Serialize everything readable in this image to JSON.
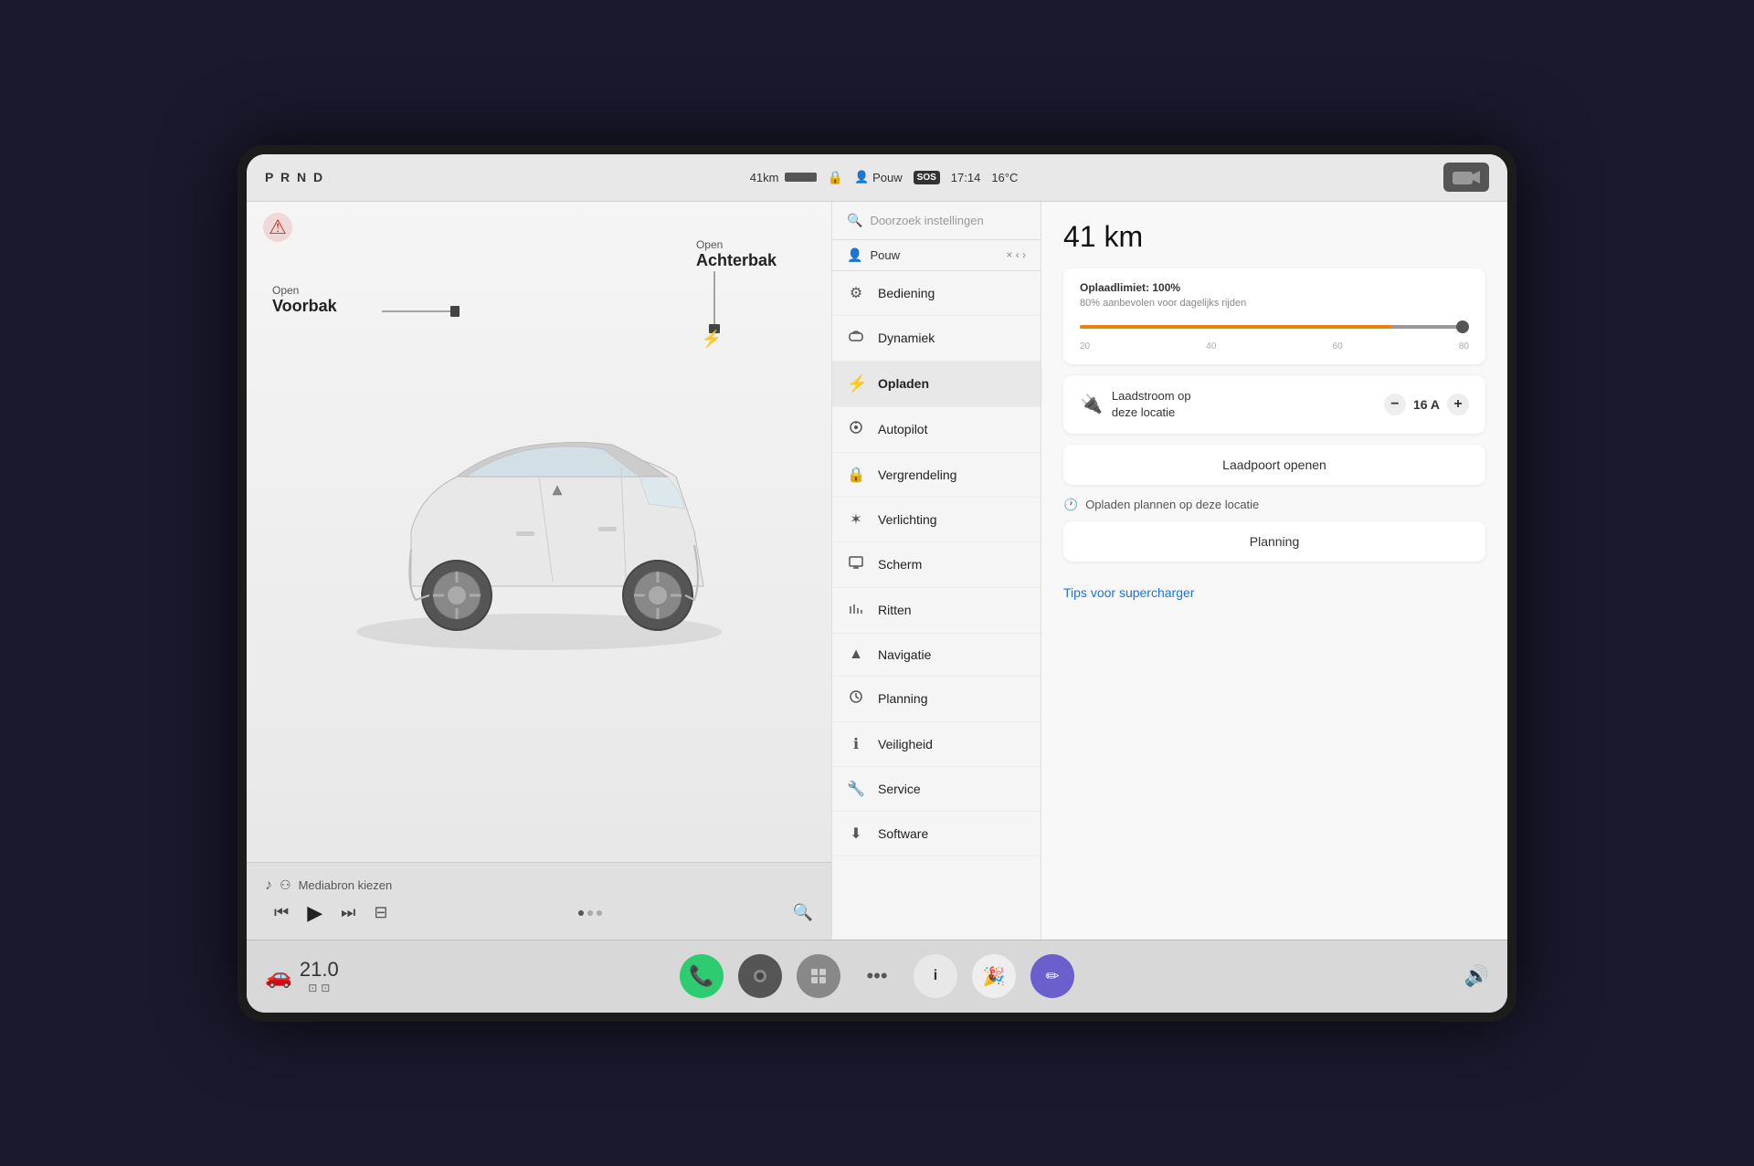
{
  "statusBar": {
    "prnd": "P R N D",
    "range": "41km",
    "driver": "Pouw",
    "sos": "SOS",
    "time": "17:14",
    "temp": "16°C"
  },
  "carPanel": {
    "labelVoorbak": "Open",
    "labelVoorbakTitle": "Voorbak",
    "labelAchterbak": "Open",
    "labelAchterbakTitle": "Achterbak"
  },
  "mediaBar": {
    "mediaLabel": "Mediabron kiezen",
    "bluetoothIcon": "bluetooth"
  },
  "settingsMenu": {
    "searchPlaceholder": "Doorzoek instellingen",
    "userName": "Pouw",
    "items": [
      {
        "id": "bediening",
        "icon": "⚙",
        "label": "Bediening",
        "active": false
      },
      {
        "id": "dynamiek",
        "icon": "🚗",
        "label": "Dynamiek",
        "active": false
      },
      {
        "id": "opladen",
        "icon": "⚡",
        "label": "Opladen",
        "active": true
      },
      {
        "id": "autopilot",
        "icon": "🎯",
        "label": "Autopilot",
        "active": false
      },
      {
        "id": "vergrendeling",
        "icon": "🔒",
        "label": "Vergrendeling",
        "active": false
      },
      {
        "id": "verlichting",
        "icon": "☀",
        "label": "Verlichting",
        "active": false
      },
      {
        "id": "scherm",
        "icon": "🖥",
        "label": "Scherm",
        "active": false
      },
      {
        "id": "ritten",
        "icon": "📊",
        "label": "Ritten",
        "active": false
      },
      {
        "id": "navigatie",
        "icon": "▲",
        "label": "Navigatie",
        "active": false
      },
      {
        "id": "planning",
        "icon": "🕐",
        "label": "Planning",
        "active": false
      },
      {
        "id": "veiligheid",
        "icon": "ℹ",
        "label": "Veiligheid",
        "active": false
      },
      {
        "id": "service",
        "icon": "🔧",
        "label": "Service",
        "active": false
      },
      {
        "id": "software",
        "icon": "⬇",
        "label": "Software",
        "active": false
      }
    ]
  },
  "chargePanel": {
    "rangeTitle": "41 km",
    "chargeLimitTitle": "Oplaadlimiet: 100%",
    "chargeLimitSubtitle": "80% aanbevolen voor dagelijks rijden",
    "chargeMarkers": [
      "20",
      "40",
      "60",
      "80"
    ],
    "chargeLimitPercent": 100,
    "chargeCurrentLabel": "Laadstroom op\ndeze locatie",
    "chargeCurrentValue": "16 A",
    "laadpoortBtn": "Laadpoort openen",
    "scheduleSectionLabel": "Opladen plannen op deze locatie",
    "schedulingBtn": "Planning",
    "superchargerLink": "Tips voor supercharger"
  },
  "taskbar": {
    "temp": "21.0",
    "phoneBtn": "📞",
    "cameraBtn": "⬤",
    "gridBtn": "▦",
    "dotsBtn": "•••",
    "calendarBtn": "i",
    "partyBtn": "🎉",
    "penBtn": "✏"
  }
}
